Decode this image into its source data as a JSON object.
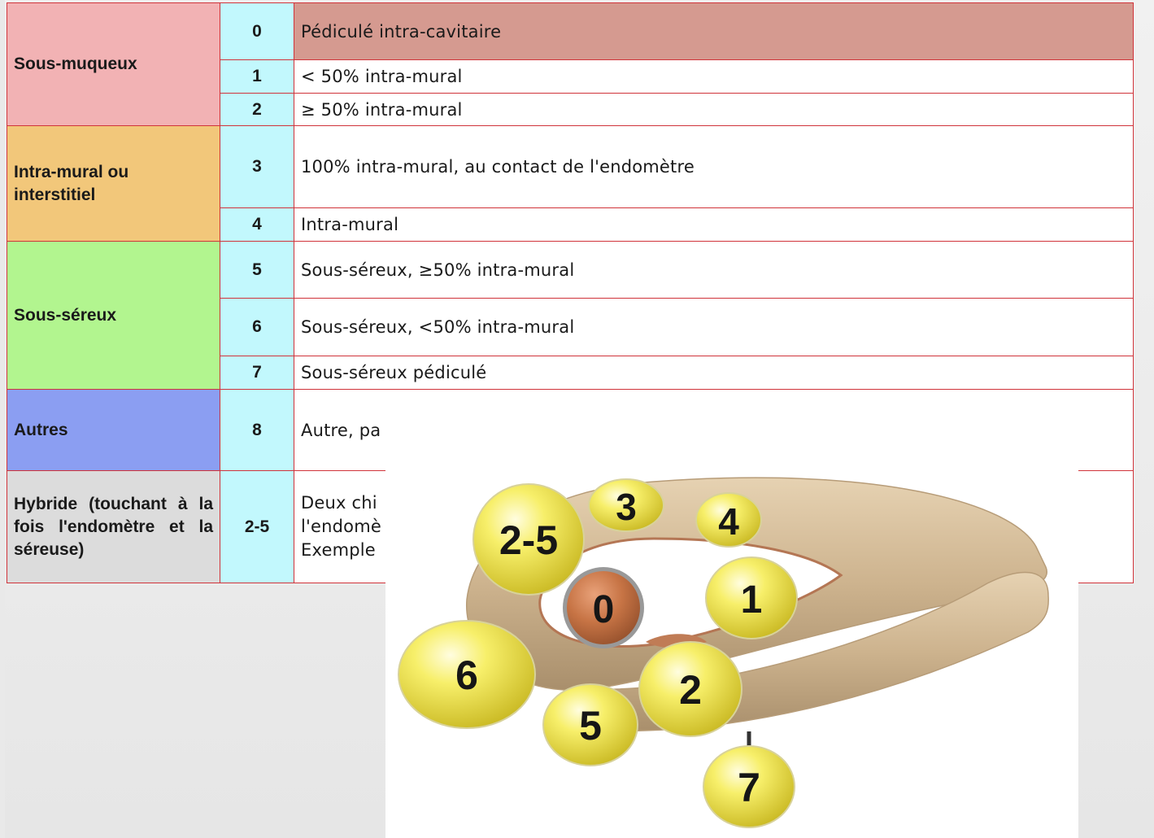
{
  "table": {
    "categories": [
      {
        "label": "Sous-muqueux",
        "color": "#f2b2b4"
      },
      {
        "label": "Intra-mural ou interstitiel",
        "color": "#f2c77a"
      },
      {
        "label": "Sous-séreux",
        "color": "#b2f58f"
      },
      {
        "label": "Autres",
        "color": "#8b9ef2"
      },
      {
        "label": "Hybride (touchant à la fois l'endomètre et la séreuse)",
        "color": "#dcdcdc"
      }
    ],
    "rows": [
      {
        "code": "0",
        "desc": "Pédiculé intra-cavitaire"
      },
      {
        "code": "1",
        "desc": "< 50% intra-mural"
      },
      {
        "code": "2",
        "desc": "≥ 50% intra-mural"
      },
      {
        "code": "3",
        "desc": "100% intra-mural, au contact de l'endomètre"
      },
      {
        "code": "4",
        "desc": "Intra-mural"
      },
      {
        "code": "5",
        "desc": "Sous-séreux, ≥50% intra-mural"
      },
      {
        "code": "6",
        "desc": "Sous-séreux, <50% intra-mural"
      },
      {
        "code": "7",
        "desc": "Sous-séreux pédiculé"
      },
      {
        "code": "8",
        "desc": "Autre, pa"
      },
      {
        "code": "2-5",
        "desc_lines": [
          "Deux chi",
          "l'endomè",
          "Exemple"
        ]
      }
    ],
    "colors": {
      "border": "#d0333a",
      "code_bg": "#c2f8fd",
      "highlight": "#d59a90"
    }
  },
  "diagram": {
    "fibroids": [
      {
        "label": "2-5"
      },
      {
        "label": "3"
      },
      {
        "label": "4"
      },
      {
        "label": "1"
      },
      {
        "label": "0"
      },
      {
        "label": "6"
      },
      {
        "label": "2"
      },
      {
        "label": "5"
      },
      {
        "label": "7"
      }
    ],
    "colors": {
      "fibroid": "#f2e95a",
      "cavity_fibroid": "#c77445",
      "uterus": "#cdb38e"
    }
  }
}
